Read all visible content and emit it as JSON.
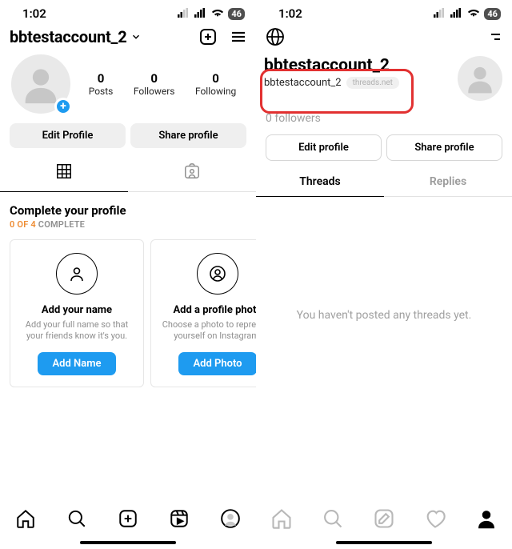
{
  "status": {
    "time": "1:02",
    "battery": "46"
  },
  "instagram": {
    "username": "bbtestaccount_2",
    "stats": {
      "posts": {
        "value": "0",
        "label": "Posts"
      },
      "followers": {
        "value": "0",
        "label": "Followers"
      },
      "following": {
        "value": "0",
        "label": "Following"
      }
    },
    "buttons": {
      "edit": "Edit Profile",
      "share": "Share profile"
    },
    "complete": {
      "title": "Complete your profile",
      "done": "0 OF 4",
      "tail": " COMPLETE"
    },
    "cards": [
      {
        "title": "Add your name",
        "desc": "Add your full name so that your friends know it's you.",
        "cta": "Add Name"
      },
      {
        "title": "Add a profile photo",
        "desc": "Choose a photo to represent yourself on Instagram.",
        "cta": "Add Photo"
      }
    ]
  },
  "threads": {
    "display_name": "bbtestaccount_2",
    "handle": "bbtestaccount_2",
    "domain_badge": "threads.net",
    "followers": "0 followers",
    "buttons": {
      "edit": "Edit profile",
      "share": "Share profile"
    },
    "tabs": {
      "threads": "Threads",
      "replies": "Replies"
    },
    "empty": "You haven't posted any threads yet."
  }
}
